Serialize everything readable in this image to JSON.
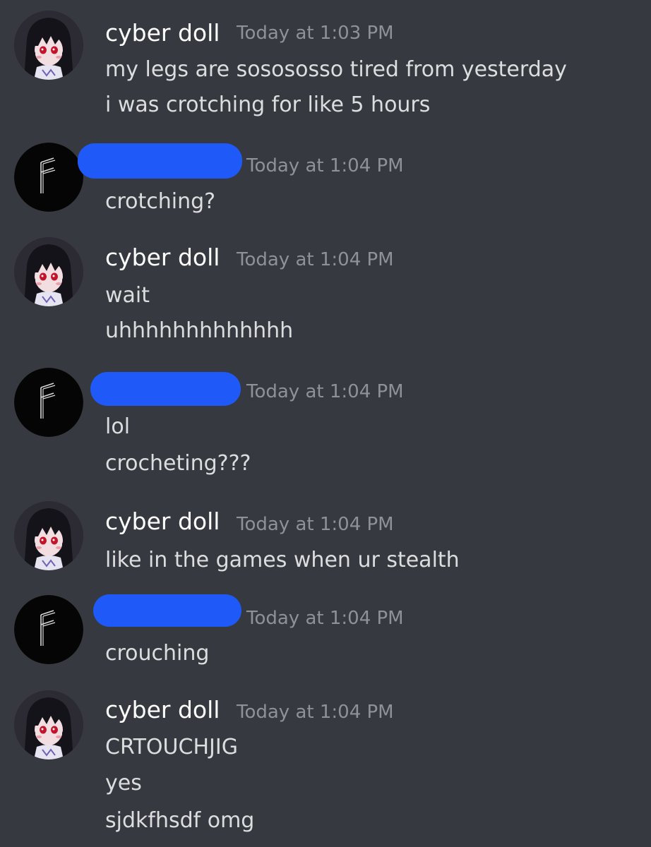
{
  "messages": [
    {
      "author": "cyber doll",
      "timestamp": "Today at 1:03 PM",
      "avatar_icon": "anime-girl-avatar-icon",
      "lines": [
        "my legs are sosososso tired from yesterday",
        "i was crotching for like 5 hours"
      ]
    },
    {
      "author": "",
      "author_redacted": true,
      "timestamp": "Today at 1:04 PM",
      "avatar_icon": "rune-f-avatar-icon",
      "lines": [
        "crotching?"
      ]
    },
    {
      "author": "cyber doll",
      "timestamp": "Today at 1:04 PM",
      "avatar_icon": "anime-girl-avatar-icon",
      "lines": [
        "wait",
        "uhhhhhhhhhhhhh"
      ]
    },
    {
      "author": "",
      "author_redacted": true,
      "timestamp": "Today at 1:04 PM",
      "avatar_icon": "rune-f-avatar-icon",
      "lines": [
        "lol",
        "crocheting???"
      ]
    },
    {
      "author": "cyber doll",
      "timestamp": "Today at 1:04 PM",
      "avatar_icon": "anime-girl-avatar-icon",
      "lines": [
        "like in the games when ur stealth"
      ]
    },
    {
      "author": "",
      "author_redacted": true,
      "timestamp": "Today at 1:04 PM",
      "avatar_icon": "rune-f-avatar-icon",
      "lines": [
        "crouching"
      ]
    },
    {
      "author": "cyber doll",
      "timestamp": "Today at 1:04 PM",
      "avatar_icon": "anime-girl-avatar-icon",
      "lines": [
        "CRTOUCHJIG",
        "yes",
        "sjdkfhsdf omg"
      ]
    }
  ],
  "colors": {
    "background": "#36393f",
    "username": "#ffffff",
    "timestamp": "#8e9297",
    "message_text": "#dcddde",
    "redaction": "#1f5af8"
  }
}
